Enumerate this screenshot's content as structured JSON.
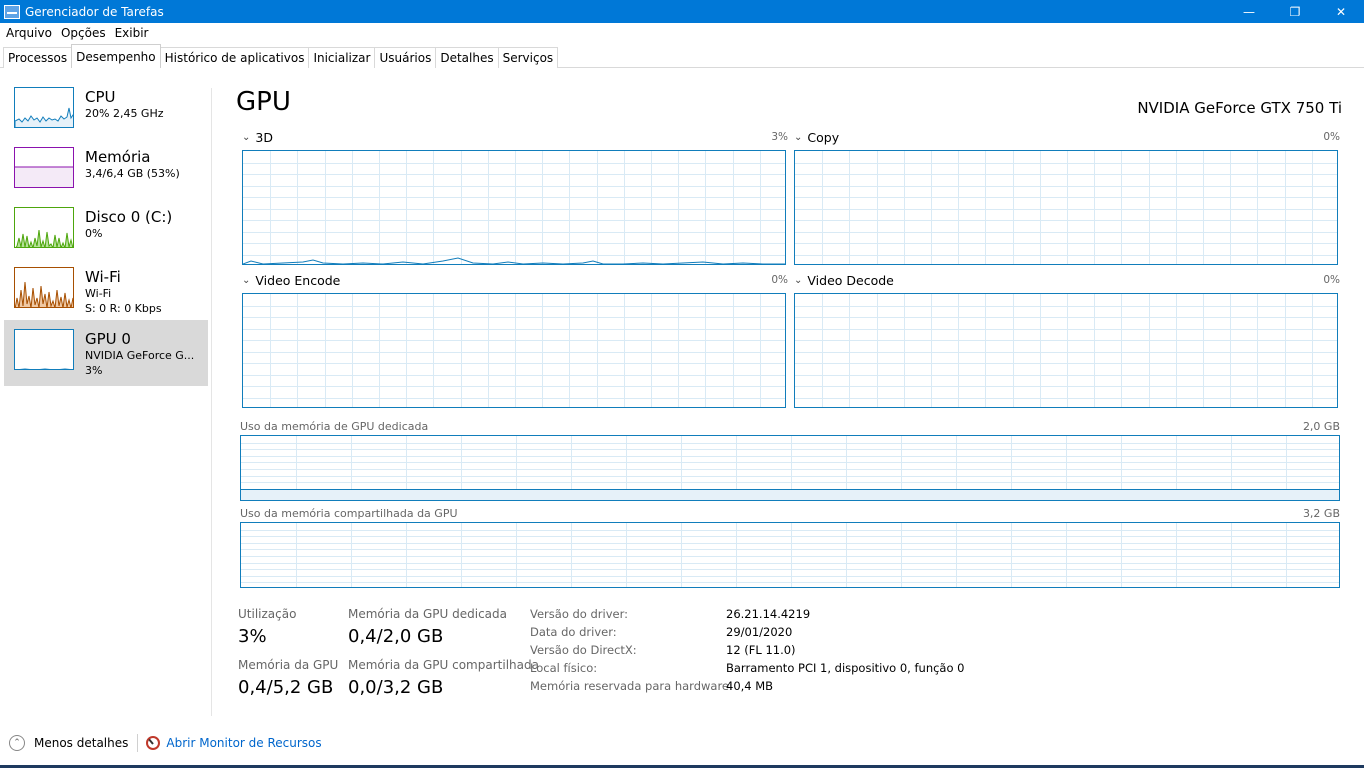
{
  "window": {
    "title": "Gerenciador de Tarefas"
  },
  "menu": [
    "Arquivo",
    "Opções",
    "Exibir"
  ],
  "tabs": [
    "Processos",
    "Desempenho",
    "Histórico de aplicativos",
    "Inicializar",
    "Usuários",
    "Detalhes",
    "Serviços"
  ],
  "sidebar": [
    {
      "title": "CPU",
      "line1": "20% 2,45 GHz",
      "line2": ""
    },
    {
      "title": "Memória",
      "line1": "3,4/6,4 GB (53%)",
      "line2": ""
    },
    {
      "title": "Disco 0 (C:)",
      "line1": "0%",
      "line2": ""
    },
    {
      "title": "Wi-Fi",
      "line1": "Wi-Fi",
      "line2": "S: 0 R: 0 Kbps"
    },
    {
      "title": "GPU 0",
      "line1": "NVIDIA GeForce G...",
      "line2": "3%"
    }
  ],
  "main": {
    "title": "GPU",
    "gpu_name": "NVIDIA GeForce GTX 750 Ti",
    "graphs": [
      {
        "label": "3D",
        "pct": "3%"
      },
      {
        "label": "Copy",
        "pct": "0%"
      },
      {
        "label": "Video Encode",
        "pct": "0%"
      },
      {
        "label": "Video Decode",
        "pct": "0%"
      }
    ],
    "dedicated_mem": {
      "label": "Uso da memória de GPU dedicada",
      "max": "2,0 GB"
    },
    "shared_mem": {
      "label": "Uso da memória compartilhada da GPU",
      "max": "3,2 GB"
    }
  },
  "stats": {
    "util_label": "Utilização",
    "util_value": "3%",
    "ded_label": "Memória da GPU dedicada",
    "ded_value": "0,4/2,0 GB",
    "gpu_mem_label": "Memória da GPU",
    "gpu_mem_value": "0,4/5,2 GB",
    "shared_label": "Memória da GPU compartilhada",
    "shared_value": "0,0/3,2 GB"
  },
  "info": [
    {
      "key": "Versão do driver:",
      "value": "26.21.14.4219"
    },
    {
      "key": "Data do driver:",
      "value": "29/01/2020"
    },
    {
      "key": "Versão do DirectX:",
      "value": "12 (FL 11.0)"
    },
    {
      "key": "Local físico:",
      "value": "Barramento PCI 1, dispositivo 0, função 0"
    },
    {
      "key": "Memória reservada para hardware:",
      "value": "40,4 MB"
    }
  ],
  "footer": {
    "less_details": "Menos detalhes",
    "open_monitor": "Abrir Monitor de Recursos"
  },
  "colors": {
    "titlebar": "#0078d7",
    "cpu": "#117dbb",
    "memory": "#8b12ae",
    "disk": "#4da60c",
    "wifi": "#a74f01",
    "gpu": "#117dbb"
  }
}
